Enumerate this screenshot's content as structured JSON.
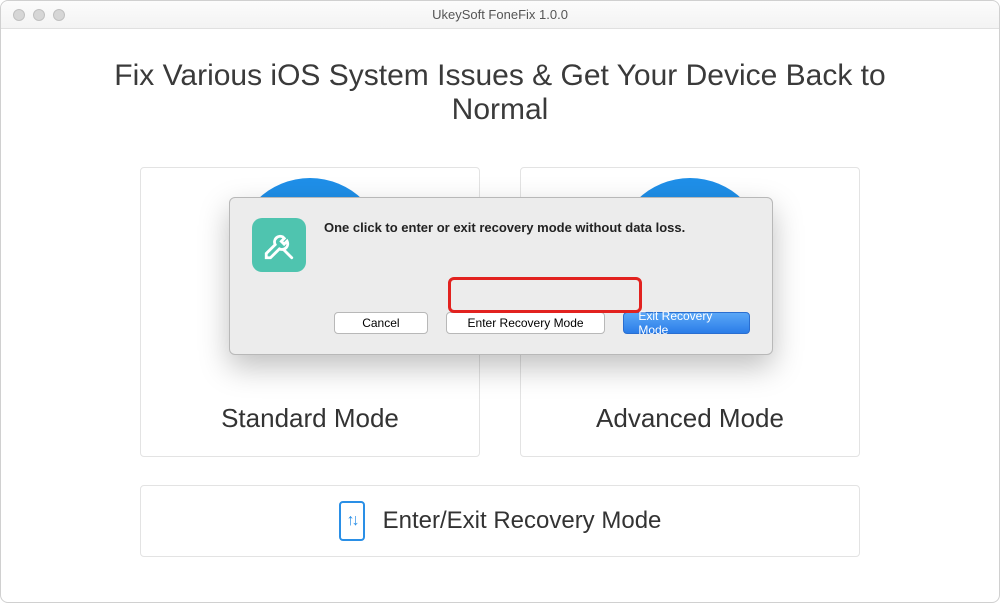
{
  "window": {
    "title": "UkeySoft FoneFix 1.0.0"
  },
  "headline": "Fix Various iOS System Issues & Get Your Device Back to Normal",
  "cards": {
    "standard": "Standard Mode",
    "advanced": "Advanced Mode"
  },
  "footer": {
    "label": "Enter/Exit Recovery Mode"
  },
  "dialog": {
    "message": "One click to enter or exit recovery mode without data loss.",
    "buttons": {
      "cancel": "Cancel",
      "enter": "Enter Recovery Mode",
      "exit": "Exit Recovery Mode"
    }
  }
}
